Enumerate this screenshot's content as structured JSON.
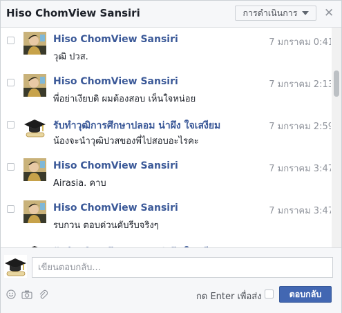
{
  "header": {
    "title": "Hiso ChomView Sansiri",
    "actions_label": "การดำเนินการ",
    "close_glyph": "✕"
  },
  "messages": [
    {
      "name": "Hiso ChomView Sansiri",
      "date": "7 มกราคม 0:41",
      "text": "วุฒิ ปวส.",
      "avatar": "profile-photo"
    },
    {
      "name": "Hiso ChomView Sansiri",
      "date": "7 มกราคม 2:13",
      "text": "พี่อย่าเงียบดิ ผมต้องสอบ เห็นใจหน่อย",
      "avatar": "profile-photo"
    },
    {
      "name": "รับทำวุฒิการศึกษาปลอม น่าผึง ใจเสงียม",
      "date": "7 มกราคม 2:59",
      "text": "น้องจะนำวุฒิปวสของพี่ไปสอบอะไรคะ",
      "avatar": "graduation-cap"
    },
    {
      "name": "Hiso ChomView Sansiri",
      "date": "7 มกราคม 3:47",
      "text": "Airasia. คาบ",
      "avatar": "profile-photo"
    },
    {
      "name": "Hiso ChomView Sansiri",
      "date": "7 มกราคม 3:47",
      "text": "รบกวน ตอบด่วนคับรีบจริงๆ",
      "avatar": "profile-photo"
    }
  ],
  "reply": {
    "placeholder": "เขียนตอบกลับ...",
    "enter_label": "กด Enter เพื่อส่ง",
    "send_label": "ตอบกลับ"
  },
  "colors": {
    "link": "#3b5998",
    "button": "#4267b2"
  }
}
